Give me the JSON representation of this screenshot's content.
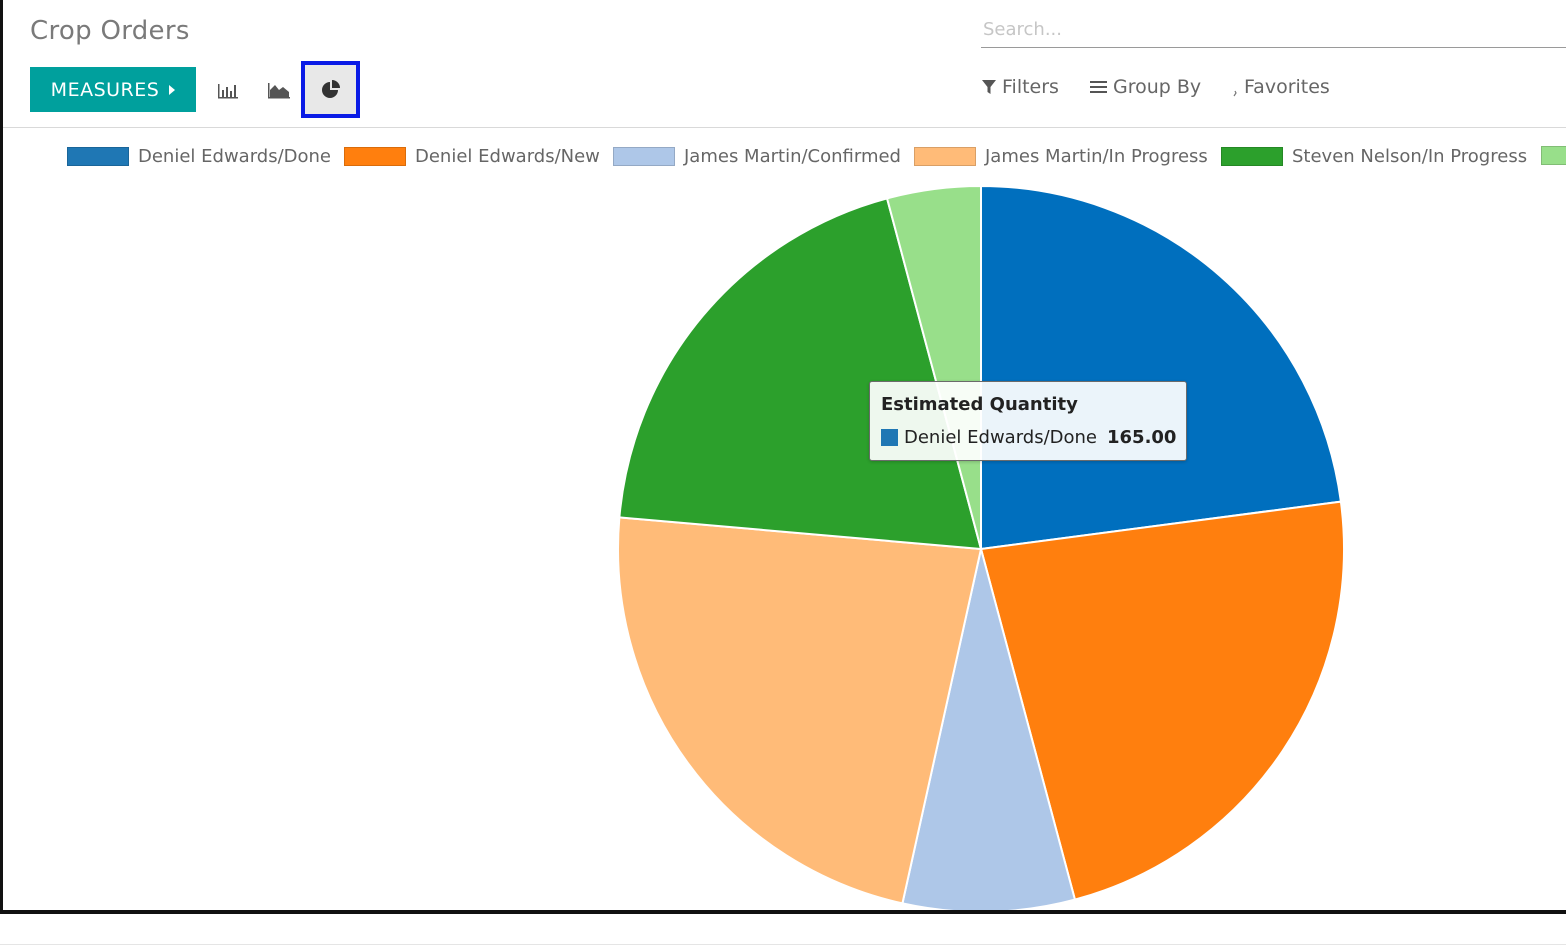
{
  "header": {
    "title": "Crop Orders",
    "search_placeholder": "Search..."
  },
  "toolbar": {
    "measures_label": "MEASURES",
    "view_buttons": [
      {
        "icon": "bar-chart-icon",
        "active": false
      },
      {
        "icon": "line-chart-icon",
        "active": false
      },
      {
        "icon": "pie-chart-icon",
        "active": true
      }
    ],
    "filters_label": "Filters",
    "group_by_label": "Group By",
    "favorites_label": "Favorites"
  },
  "chart_data": {
    "type": "pie",
    "series_label": "Estimated Quantity",
    "legend_position": "top",
    "categories": [
      "Deniel Edwards/Done",
      "Deniel Edwards/New",
      "James Martin/Confirmed",
      "James Martin/In Progress",
      "Steven Nelson/In Progress",
      ""
    ],
    "values": [
      165,
      165,
      55,
      165,
      140,
      30
    ],
    "colors": [
      "#006fbe",
      "#ff7f0e",
      "#aec7e8",
      "#ffbb78",
      "#2ca02c",
      "#98df8a"
    ]
  },
  "tooltip": {
    "title": "Estimated Quantity",
    "label": "Deniel Edwards/Done",
    "value": "165.00",
    "swatch_color": "#1f77b4"
  }
}
